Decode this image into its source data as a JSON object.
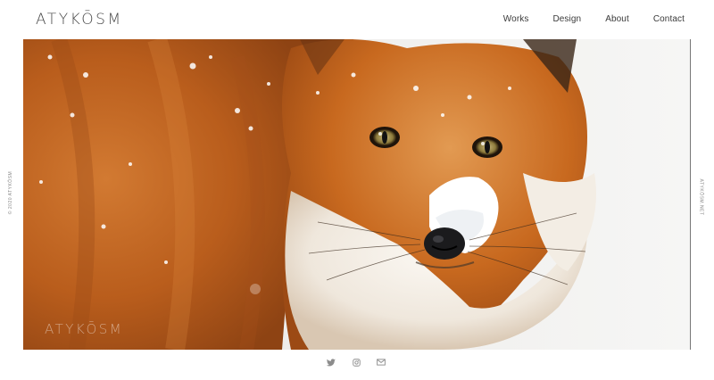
{
  "header": {
    "logo": "ATYKŌSM",
    "nav": [
      {
        "label": "Works"
      },
      {
        "label": "Design"
      },
      {
        "label": "About"
      },
      {
        "label": "Contact"
      }
    ]
  },
  "hero": {
    "image": "red-fox-in-snow-photo",
    "watermark": "ATYKŌSM"
  },
  "side": {
    "left_text": "© 2020 ATYKŌSM",
    "right_text": "ATYKŌSM.NET"
  },
  "footer": {
    "social": [
      {
        "icon": "twitter-icon"
      },
      {
        "icon": "instagram-icon"
      },
      {
        "icon": "mail-icon"
      }
    ]
  },
  "colors": {
    "text": "#3a3a3a",
    "muted": "#8a8a8a",
    "fox_orange": "#c8661f",
    "snow": "#f2f2f1"
  }
}
